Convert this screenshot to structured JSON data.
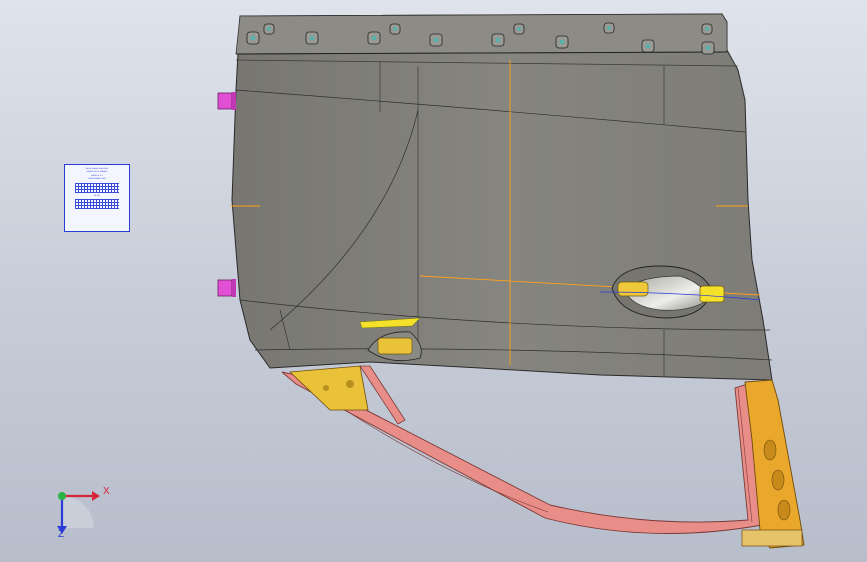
{
  "viewport": {
    "background": "#c8ced9",
    "accent_colors": {
      "panel_fill": "#7f7e78",
      "frame_pink": "#e98d88",
      "hinge_orange": "#e9a72c",
      "feature_yellow": "#f5e12a",
      "clip_magenta": "#e14fd4",
      "sketch_orange": "#ffa21c",
      "sketch_blue": "#2a3bd6"
    }
  },
  "triad": {
    "x_label": "X",
    "z_label": "Z",
    "x_color": "#d4283a",
    "y_color": "#2ab446",
    "z_color": "#2a3bd6"
  },
  "info_card": {
    "lines": [
      "▪▪▪ ▪▪ ▪▪▪▪▪▪▪ ▪▪▪▪▪ ▪▪▪▪",
      "▪▪▪▪▪▪▪ ▪▪▪ ▪▪ ▪▪▪▪▪▪▪▪",
      "▪▪▪▪▪▪ ▪▪  ▪  ▪",
      "▪▪▪▪▪▪ ▪▪▪▪▪▪▪ ▪▪▪▪",
      "▪▪ ▪▪▪"
    ],
    "border_color": "#2a3bd6"
  }
}
